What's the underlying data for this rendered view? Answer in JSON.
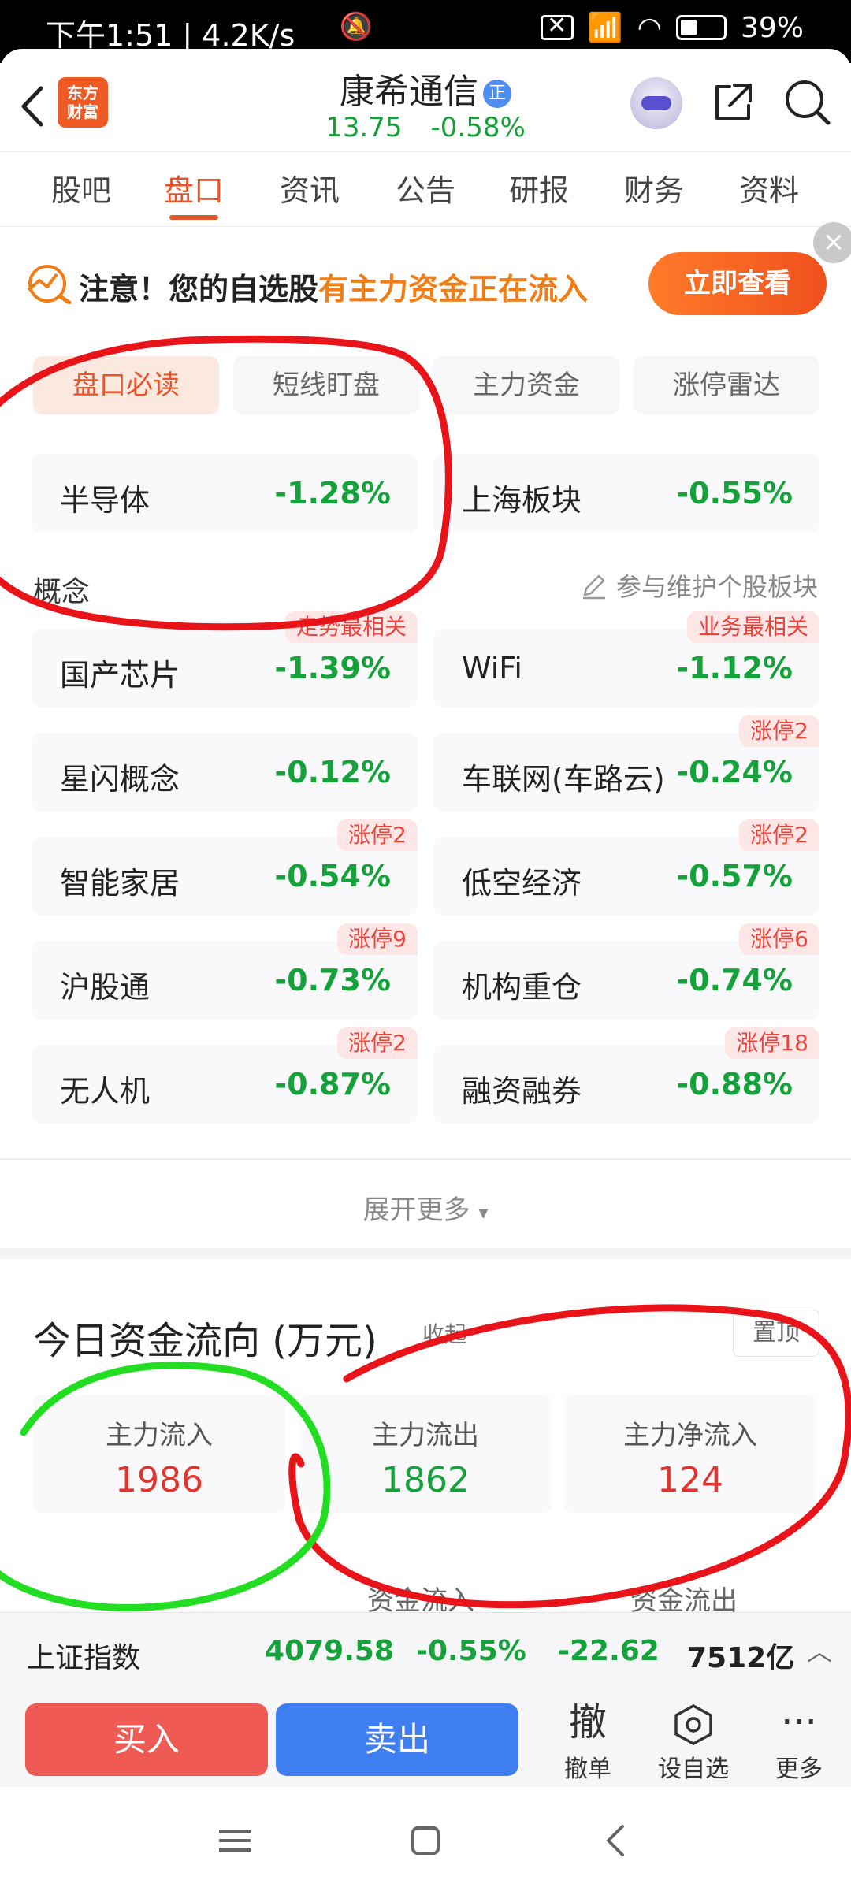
{
  "status_bar": {
    "time": "下午1:51 | 4.2K/s",
    "battery": "39%"
  },
  "header": {
    "stock_name": "康希通信",
    "badge": "正",
    "price": "13.75",
    "change_pct": "-0.58%",
    "logo_text_1": "东方",
    "logo_text_2": "财富"
  },
  "tabs": [
    "股吧",
    "盘口",
    "资讯",
    "公告",
    "研报",
    "财务",
    "资料"
  ],
  "notice": {
    "prefix": "注意！您的自选股",
    "highlight": "有主力资金正在流入",
    "button": "立即查看"
  },
  "subtabs": [
    "盘口必读",
    "短线盯盘",
    "主力资金",
    "涨停雷达"
  ],
  "industry": [
    {
      "name": "半导体",
      "pct": "-1.28%"
    },
    {
      "name": "上海板块",
      "pct": "-0.55%"
    }
  ],
  "concept_label": "概念",
  "maintain_label": "参与维护个股板块",
  "concepts": [
    {
      "name": "国产芯片",
      "pct": "-1.39%",
      "tag": "走势最相关"
    },
    {
      "name": "WiFi",
      "pct": "-1.12%",
      "tag": "业务最相关"
    },
    {
      "name": "星闪概念",
      "pct": "-0.12%",
      "tag": ""
    },
    {
      "name": "车联网(车路云)",
      "pct": "-0.24%",
      "tag": "涨停2"
    },
    {
      "name": "智能家居",
      "pct": "-0.54%",
      "tag": "涨停2"
    },
    {
      "name": "低空经济",
      "pct": "-0.57%",
      "tag": "涨停2"
    },
    {
      "name": "沪股通",
      "pct": "-0.73%",
      "tag": "涨停9"
    },
    {
      "name": "机构重仓",
      "pct": "-0.74%",
      "tag": "涨停6"
    },
    {
      "name": "无人机",
      "pct": "-0.87%",
      "tag": "涨停2"
    },
    {
      "name": "融资融券",
      "pct": "-0.88%",
      "tag": "涨停18"
    }
  ],
  "expand_label": "展开更多",
  "money_flow": {
    "title": "今日资金流向 (万元)",
    "collapse": "收起",
    "pin": "置顶",
    "inflow_label": "主力流入",
    "inflow_value": "1986",
    "outflow_label": "主力流出",
    "outflow_value": "1862",
    "net_label": "主力净流入",
    "net_value": "124",
    "sub_in": "资金流入",
    "sub_out": "资金流出"
  },
  "index_bar": {
    "name": "上证指数",
    "value": "4079.58",
    "pct": "-0.55%",
    "change": "-22.62",
    "amount": "7512亿"
  },
  "trade_bar": {
    "buy": "买入",
    "sell": "卖出",
    "cancel_icon_text": "撤",
    "cancel": "撤单",
    "watch": "设自选",
    "more": "更多"
  },
  "colors": {
    "accent": "#e8542a",
    "down_green": "#15a23a",
    "up_red": "#e0352f",
    "buy_red": "#ef5a55",
    "sell_blue": "#3f7ef0",
    "annotation_red": "#e8141a",
    "annotation_green": "#22dd22"
  }
}
